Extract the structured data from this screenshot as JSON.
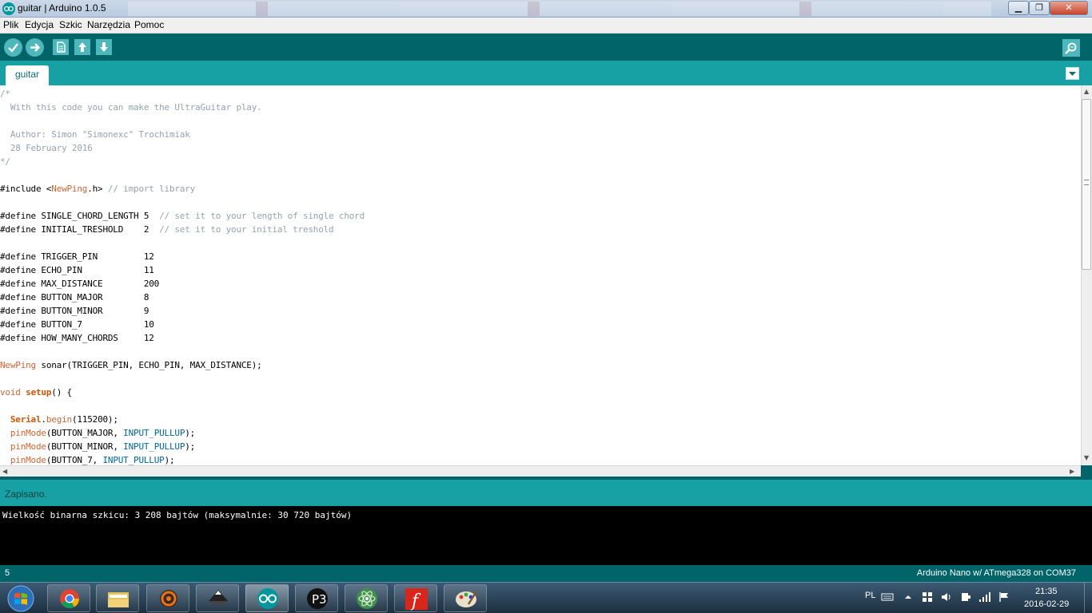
{
  "window": {
    "title": "guitar | Arduino 1.0.5"
  },
  "menu": {
    "items": [
      "Plik",
      "Edycja",
      "Szkic",
      "Narzędzia",
      "Pomoc"
    ]
  },
  "toolbar": {
    "icons": [
      "verify-icon",
      "upload-icon",
      "new-icon",
      "open-icon",
      "save-icon",
      "serial-monitor-icon"
    ]
  },
  "tabs": [
    {
      "label": "guitar",
      "active": true
    }
  ],
  "editor": {
    "lines": [
      [
        {
          "t": "/*",
          "c": "cm"
        }
      ],
      [
        {
          "t": "  With this code you can make the UltraGuitar play.",
          "c": "cm"
        }
      ],
      [],
      [
        {
          "t": "  Author: Simon \"Simonexc\" Trochimiak",
          "c": "cm"
        }
      ],
      [
        {
          "t": "  28 February 2016",
          "c": "cm"
        }
      ],
      [
        {
          "t": "*/",
          "c": "cm"
        }
      ],
      [],
      [
        {
          "t": "#include <"
        },
        {
          "t": "NewPing",
          "c": "kw"
        },
        {
          "t": ".h> "
        },
        {
          "t": "// import library",
          "c": "cm"
        }
      ],
      [],
      [
        {
          "t": "#define SINGLE_CHORD_LENGTH 5  "
        },
        {
          "t": "// set it to your length of single chord",
          "c": "cm"
        }
      ],
      [
        {
          "t": "#define INITIAL_TRESHOLD    2  "
        },
        {
          "t": "// set it to your initial treshold",
          "c": "cm"
        }
      ],
      [],
      [
        {
          "t": "#define TRIGGER_PIN         12"
        }
      ],
      [
        {
          "t": "#define ECHO_PIN            11"
        }
      ],
      [
        {
          "t": "#define MAX_DISTANCE        200"
        }
      ],
      [
        {
          "t": "#define BUTTON_MAJOR        8"
        }
      ],
      [
        {
          "t": "#define BUTTON_MINOR        9"
        }
      ],
      [
        {
          "t": "#define BUTTON_7            10"
        }
      ],
      [
        {
          "t": "#define HOW_MANY_CHORDS     12"
        }
      ],
      [],
      [
        {
          "t": "NewPing",
          "c": "kw"
        },
        {
          "t": " sonar(TRIGGER_PIN, ECHO_PIN, MAX_DISTANCE);"
        }
      ],
      [],
      [
        {
          "t": "void",
          "c": "ty"
        },
        {
          "t": " "
        },
        {
          "t": "setup",
          "c": "fn"
        },
        {
          "t": "() {"
        }
      ],
      [],
      [
        {
          "t": "  "
        },
        {
          "t": "Serial",
          "c": "fn"
        },
        {
          "t": "."
        },
        {
          "t": "begin",
          "c": "kw"
        },
        {
          "t": "(115200);"
        }
      ],
      [
        {
          "t": "  "
        },
        {
          "t": "pinMode",
          "c": "kw"
        },
        {
          "t": "(BUTTON_MAJOR, "
        },
        {
          "t": "INPUT_PULLUP",
          "c": "cs"
        },
        {
          "t": ");"
        }
      ],
      [
        {
          "t": "  "
        },
        {
          "t": "pinMode",
          "c": "kw"
        },
        {
          "t": "(BUTTON_MINOR, "
        },
        {
          "t": "INPUT_PULLUP",
          "c": "cs"
        },
        {
          "t": ");"
        }
      ],
      [
        {
          "t": "  "
        },
        {
          "t": "pinMode",
          "c": "kw"
        },
        {
          "t": "(BUTTON_7, "
        },
        {
          "t": "INPUT_PULLUP",
          "c": "cs"
        },
        {
          "t": ");"
        }
      ]
    ]
  },
  "status": {
    "message": "Zapisano."
  },
  "console": {
    "text": "Wielkość binarna szkicu: 3 208 bajtów (maksymalnie: 30 720 bajtów)"
  },
  "footer": {
    "line_number": "5",
    "board": "Arduino Nano w/ ATmega328 on COM37"
  },
  "taskbar": {
    "apps": [
      "chrome-icon",
      "file-explorer-icon",
      "orange-ring-icon",
      "inkscape-icon",
      "arduino-icon",
      "p3-icon",
      "atom-icon",
      "f-icon",
      "paint-icon"
    ],
    "active_app": "arduino-icon",
    "tray": {
      "language": "PL",
      "time": "21:35",
      "date": "2016-02-29"
    }
  },
  "colors": {
    "arduino_dark": "#006468",
    "arduino_teal": "#17a1a5",
    "arduino_button": "#4db7bb",
    "comment": "#95a3ab",
    "keyword": "#cc6633"
  }
}
